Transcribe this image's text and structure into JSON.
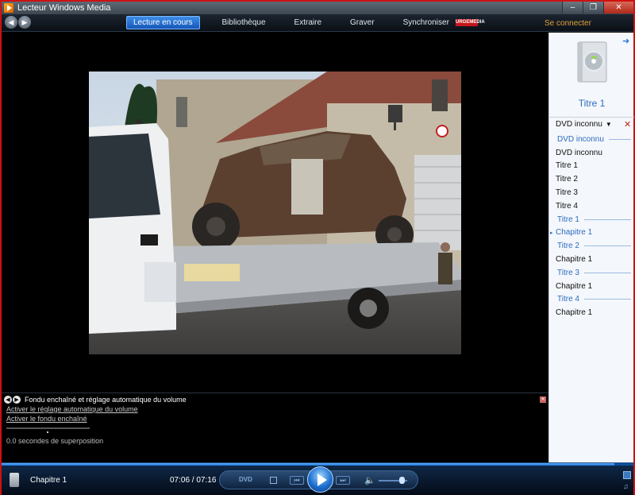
{
  "window": {
    "title": "Lecteur Windows Media"
  },
  "nav": {
    "tabs": [
      {
        "label": "Lecture en cours",
        "active": true
      },
      {
        "label": "Bibliothèque"
      },
      {
        "label": "Extraire"
      },
      {
        "label": "Graver"
      },
      {
        "label": "Synchroniser"
      }
    ],
    "brand": "URGEMEDIA",
    "connect": "Se connecter"
  },
  "pane": {
    "title": "Titre 1",
    "dvd_label": "DVD inconnu",
    "tree": [
      {
        "label": "DVD inconnu",
        "kind": "header"
      },
      {
        "label": "DVD inconnu",
        "kind": "item"
      },
      {
        "label": "Titre 1",
        "kind": "item"
      },
      {
        "label": "Titre 2",
        "kind": "item"
      },
      {
        "label": "Titre 3",
        "kind": "item"
      },
      {
        "label": "Titre 4",
        "kind": "item"
      },
      {
        "label": "Titre 1",
        "kind": "header"
      },
      {
        "label": "Chapitre 1",
        "kind": "selected"
      },
      {
        "label": "Titre 2",
        "kind": "header"
      },
      {
        "label": "Chapitre 1",
        "kind": "item"
      },
      {
        "label": "Titre 3",
        "kind": "header"
      },
      {
        "label": "Chapitre 1",
        "kind": "item"
      },
      {
        "label": "Titre 4",
        "kind": "header"
      },
      {
        "label": "Chapitre 1",
        "kind": "item"
      }
    ]
  },
  "enhancements": {
    "title": "Fondu enchaîné et réglage automatique du volume",
    "link_volume": "Activer le réglage automatique du volume",
    "link_crossfade": "Activer le fondu enchaîné",
    "status": "0.0 secondes de superposition"
  },
  "controls": {
    "now_playing": "Chapitre 1",
    "time": "07:06 / 07:16",
    "dvd_label": "DVD",
    "seek_progress": 0.97,
    "volume_level": 0.8
  },
  "colors": {
    "accent": "#1e6fd8",
    "frame": "#d01010",
    "connect": "#e0a23a"
  }
}
